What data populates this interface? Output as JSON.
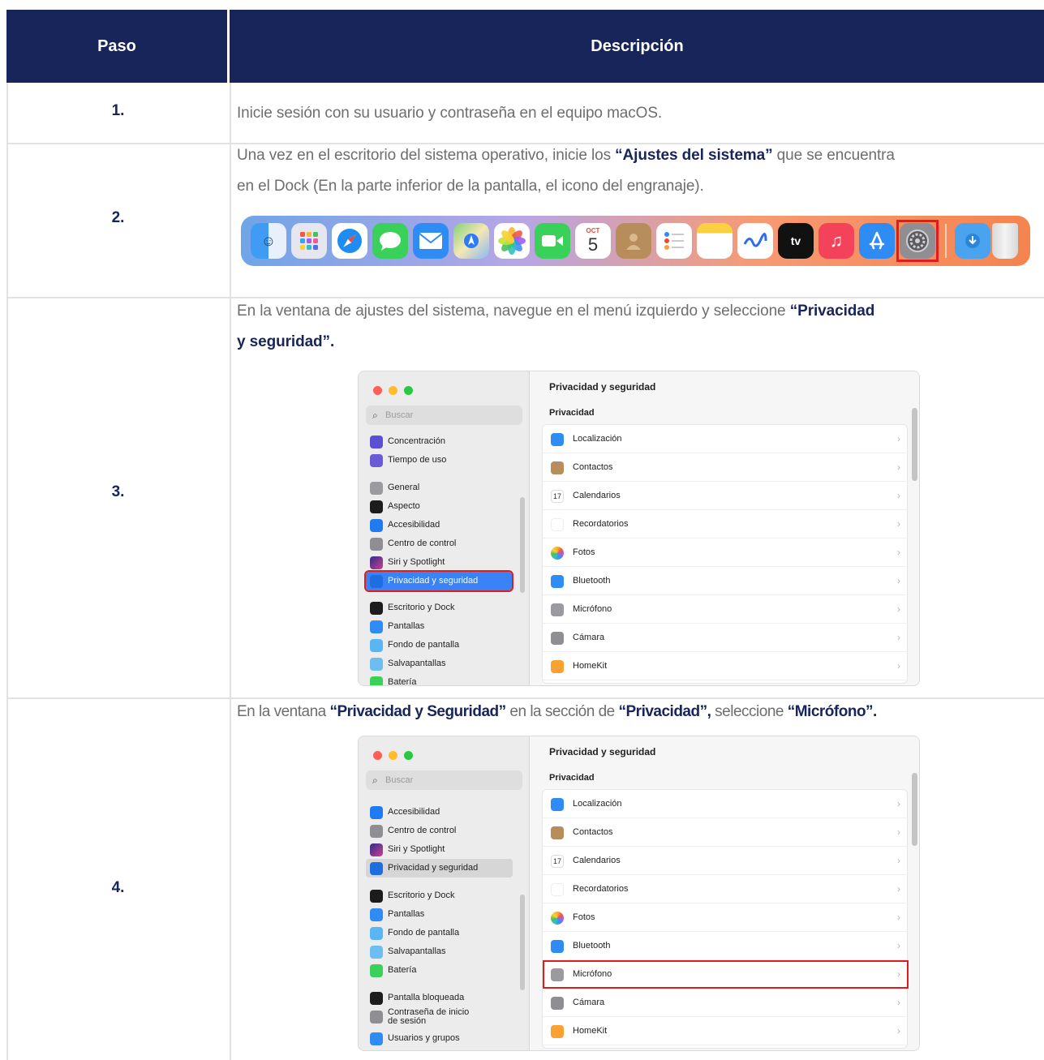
{
  "header": {
    "step": "Paso",
    "description": "Descripción"
  },
  "rows": [
    {
      "step": "1.",
      "text": "Inicie sesión con su usuario y contraseña en el equipo macOS."
    },
    {
      "step": "2.",
      "line1_a": "Una vez en el escritorio del sistema operativo, inicie los ",
      "line1_b": "“Ajustes del sistema”",
      "line1_c": " que se encuentra",
      "line2": "en el Dock (En la parte inferior de la pantalla, el icono del engranaje)."
    },
    {
      "step": "3.",
      "line1_a": "En la ventana de ajustes del sistema, navegue en el menú izquierdo y seleccione ",
      "line1_b": "“Privacidad",
      "line2_b": "y seguridad”."
    },
    {
      "step": "4.",
      "t_a": "En la ventana ",
      "t_b": "“Privacidad y Seguridad”",
      "t_c": " en la sección de ",
      "t_d": "“Privacidad”,",
      "t_e": " seleccione ",
      "t_f": "“Micrófono”."
    }
  ],
  "dock": {
    "calendar_month": "OCT",
    "calendar_day": "5",
    "tv_label": "tv",
    "icons": [
      "finder-icon",
      "launchpad-icon",
      "safari-icon",
      "messages-icon",
      "mail-icon",
      "maps-icon",
      "photos-icon",
      "facetime-icon",
      "calendar-icon",
      "contacts-icon",
      "reminders-icon",
      "notes-icon",
      "freeform-icon",
      "apple-tv-icon",
      "music-icon",
      "app-store-icon",
      "system-settings-icon",
      "downloads-icon",
      "trash-icon"
    ]
  },
  "settings": {
    "search_placeholder": "Buscar",
    "title": "Privacidad y seguridad",
    "section": "Privacidad",
    "chevron": "›",
    "calendar_day": "17",
    "sidebar_a": [
      "Concentración",
      "Tiempo de uso",
      "General",
      "Aspecto",
      "Accesibilidad",
      "Centro de control",
      "Siri y Spotlight",
      "Privacidad y seguridad",
      "Escritorio y Dock",
      "Pantallas",
      "Fondo de pantalla",
      "Salvapantallas",
      "Batería"
    ],
    "sidebar_b": [
      "Accesibilidad",
      "Centro de control",
      "Siri y Spotlight",
      "Privacidad y seguridad",
      "Escritorio y Dock",
      "Pantallas",
      "Fondo de pantalla",
      "Salvapantallas",
      "Batería",
      "Pantalla bloqueada",
      "Contraseña de inicio",
      "de sesión",
      "Usuarios y grupos"
    ],
    "main_items": [
      "Localización",
      "Contactos",
      "Calendarios",
      "Recordatorios",
      "Fotos",
      "Bluetooth",
      "Micrófono",
      "Cámara",
      "HomeKit"
    ]
  },
  "colors": {
    "header_bg": "#17255a",
    "accent_text": "#17255a",
    "highlight": "#e01c1c",
    "selected": "#3a82f7"
  }
}
